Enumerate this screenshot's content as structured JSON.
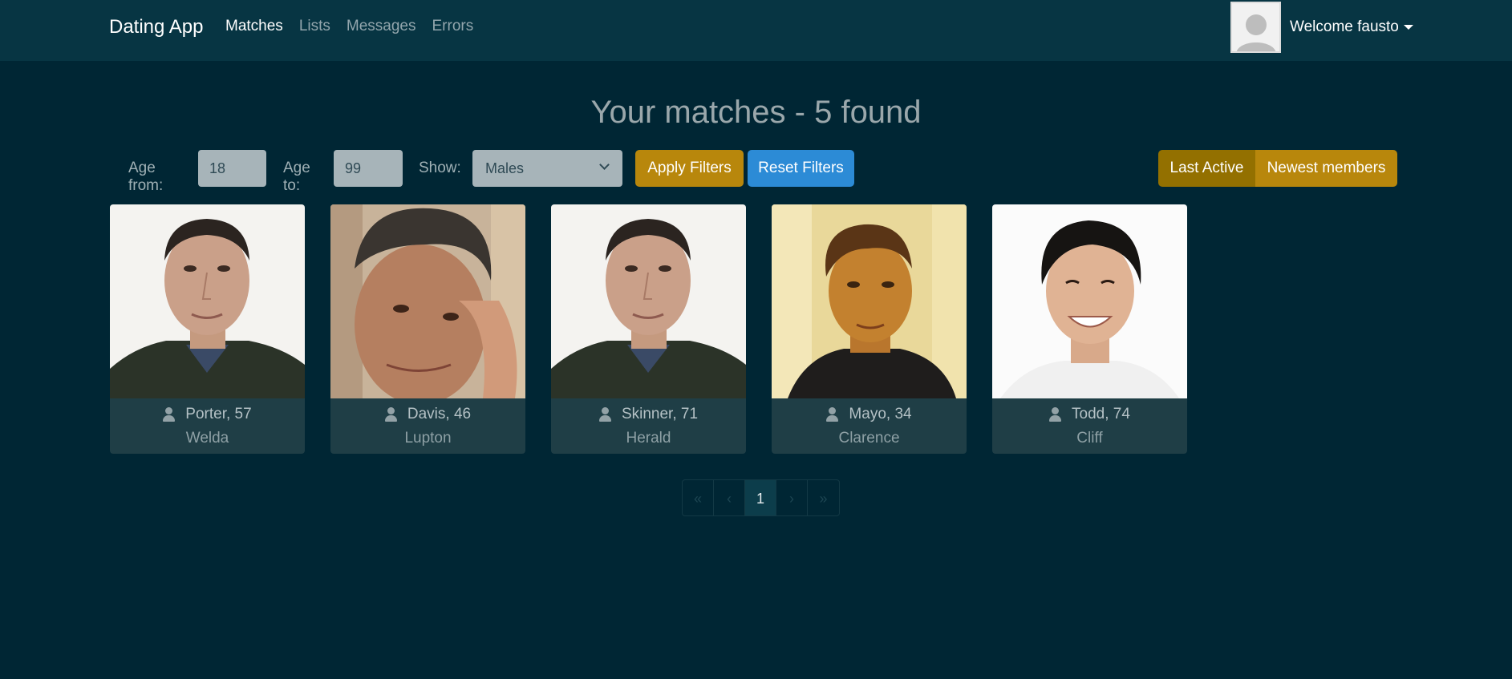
{
  "navbar": {
    "brand": "Dating App",
    "links": [
      {
        "label": "Matches",
        "active": true
      },
      {
        "label": "Lists",
        "active": false
      },
      {
        "label": "Messages",
        "active": false
      },
      {
        "label": "Errors",
        "active": false
      }
    ],
    "welcome": "Welcome fausto",
    "avatar_icon": "user-placeholder-icon"
  },
  "title": "Your matches - 5 found",
  "filters": {
    "age_from_label": "Age from:",
    "age_from_value": "18",
    "age_to_label": "Age to:",
    "age_to_value": "99",
    "show_label": "Show:",
    "show_value": "Males",
    "apply_label": "Apply Filters",
    "reset_label": "Reset Filters"
  },
  "sort": {
    "last_active_label": "Last Active",
    "newest_label": "Newest members",
    "active": "Last Active"
  },
  "members": [
    {
      "name_age": "Porter, 57",
      "city": "Welda"
    },
    {
      "name_age": "Davis, 46",
      "city": "Lupton"
    },
    {
      "name_age": "Skinner, 71",
      "city": "Herald"
    },
    {
      "name_age": "Mayo, 34",
      "city": "Clarence"
    },
    {
      "name_age": "Todd, 74",
      "city": "Cliff"
    }
  ],
  "pagination": {
    "first": "«",
    "prev": "‹",
    "current": "1",
    "next": "›",
    "last": "»"
  },
  "colors": {
    "background": "#002634",
    "navbar": "#073543",
    "gold": "#b8870c",
    "gold_active": "#937000",
    "blue": "#2c8bd6"
  }
}
